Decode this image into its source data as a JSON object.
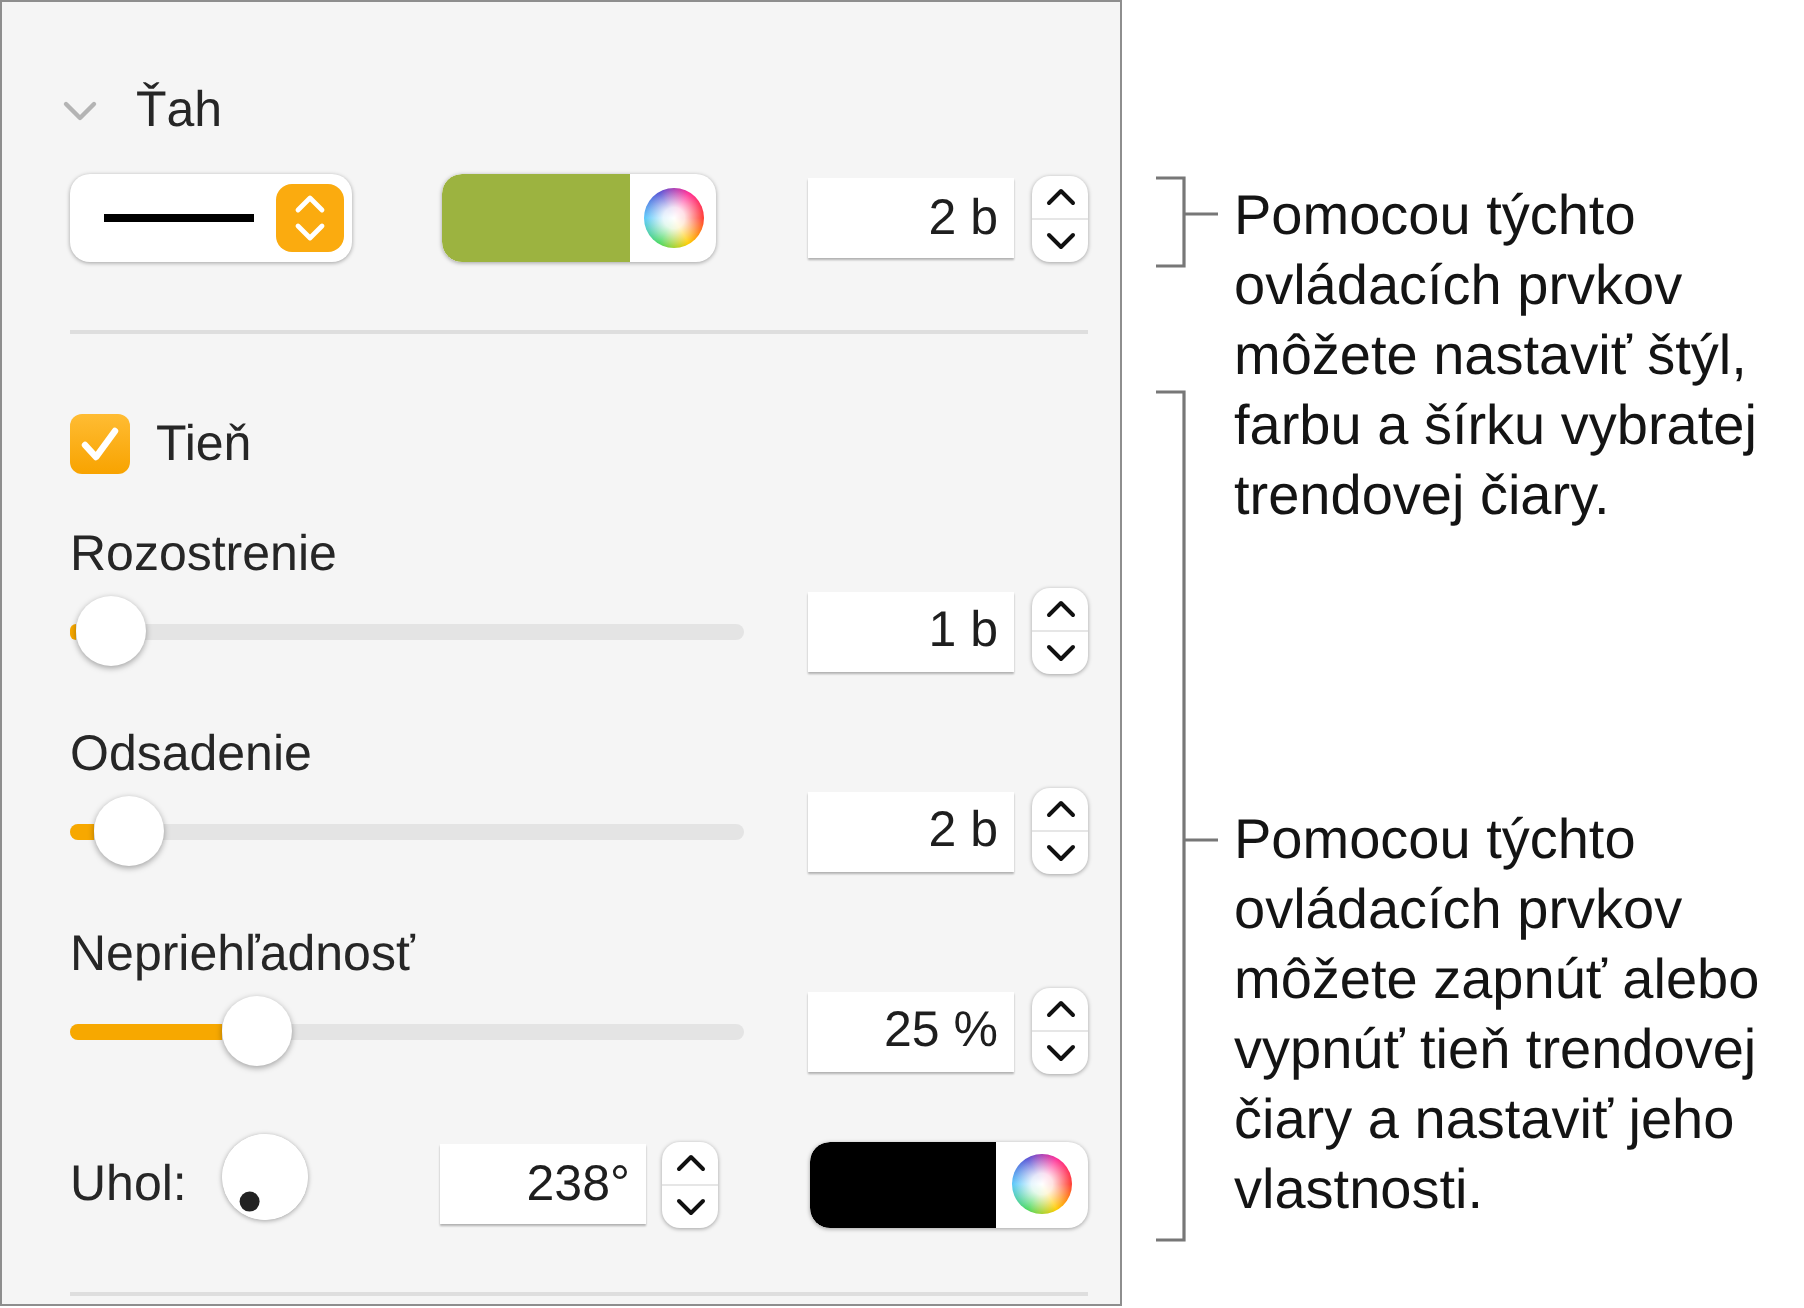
{
  "stroke": {
    "title": "Ťah",
    "expanded": true,
    "color": "#9cb340",
    "width": "2 b"
  },
  "shadow": {
    "label": "Tieň",
    "checked": true,
    "sliders": [
      {
        "label": "Rozostrenie",
        "level": 0.01,
        "value": "1 b"
      },
      {
        "label": "Odsadenie",
        "level": 0.04,
        "value": "2 b"
      },
      {
        "label": "Nepriehľadnosť",
        "level": 0.25,
        "value": "25 %"
      }
    ],
    "angle": {
      "label": "Uhol:",
      "value": "238°"
    },
    "color": "#000000"
  },
  "callouts": [
    "Pomocou týchto ovládacích prvkov môžete nastaviť štýl, farbu a šírku vybratej trendovej čiary.",
    "Pomocou týchto ovládacích prvkov môžete zapnúť alebo vypnúť tieň trendovej čiary a nastaviť jeho vlastnosti."
  ]
}
